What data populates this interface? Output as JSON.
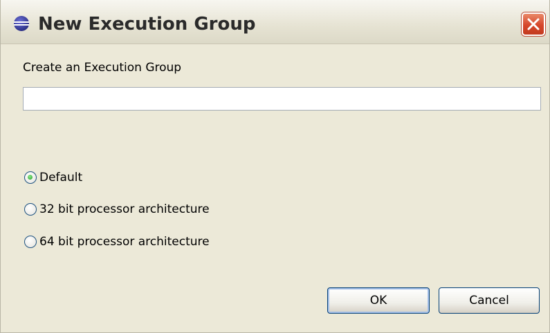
{
  "window": {
    "title": "New Execution Group",
    "title_icon": "eclipse-icon",
    "close_icon": "close-icon",
    "colors": {
      "background": "#ece9d8",
      "close_button": "#d6462a",
      "radio_selected": "#21a121",
      "button_border": "#003c74"
    }
  },
  "form": {
    "prompt": "Create an Execution Group",
    "name_value": "",
    "options": [
      {
        "label": "Default",
        "selected": true
      },
      {
        "label": "32 bit processor architecture",
        "selected": false
      },
      {
        "label": "64 bit processor architecture",
        "selected": false
      }
    ]
  },
  "buttons": {
    "ok_label": "OK",
    "cancel_label": "Cancel"
  }
}
